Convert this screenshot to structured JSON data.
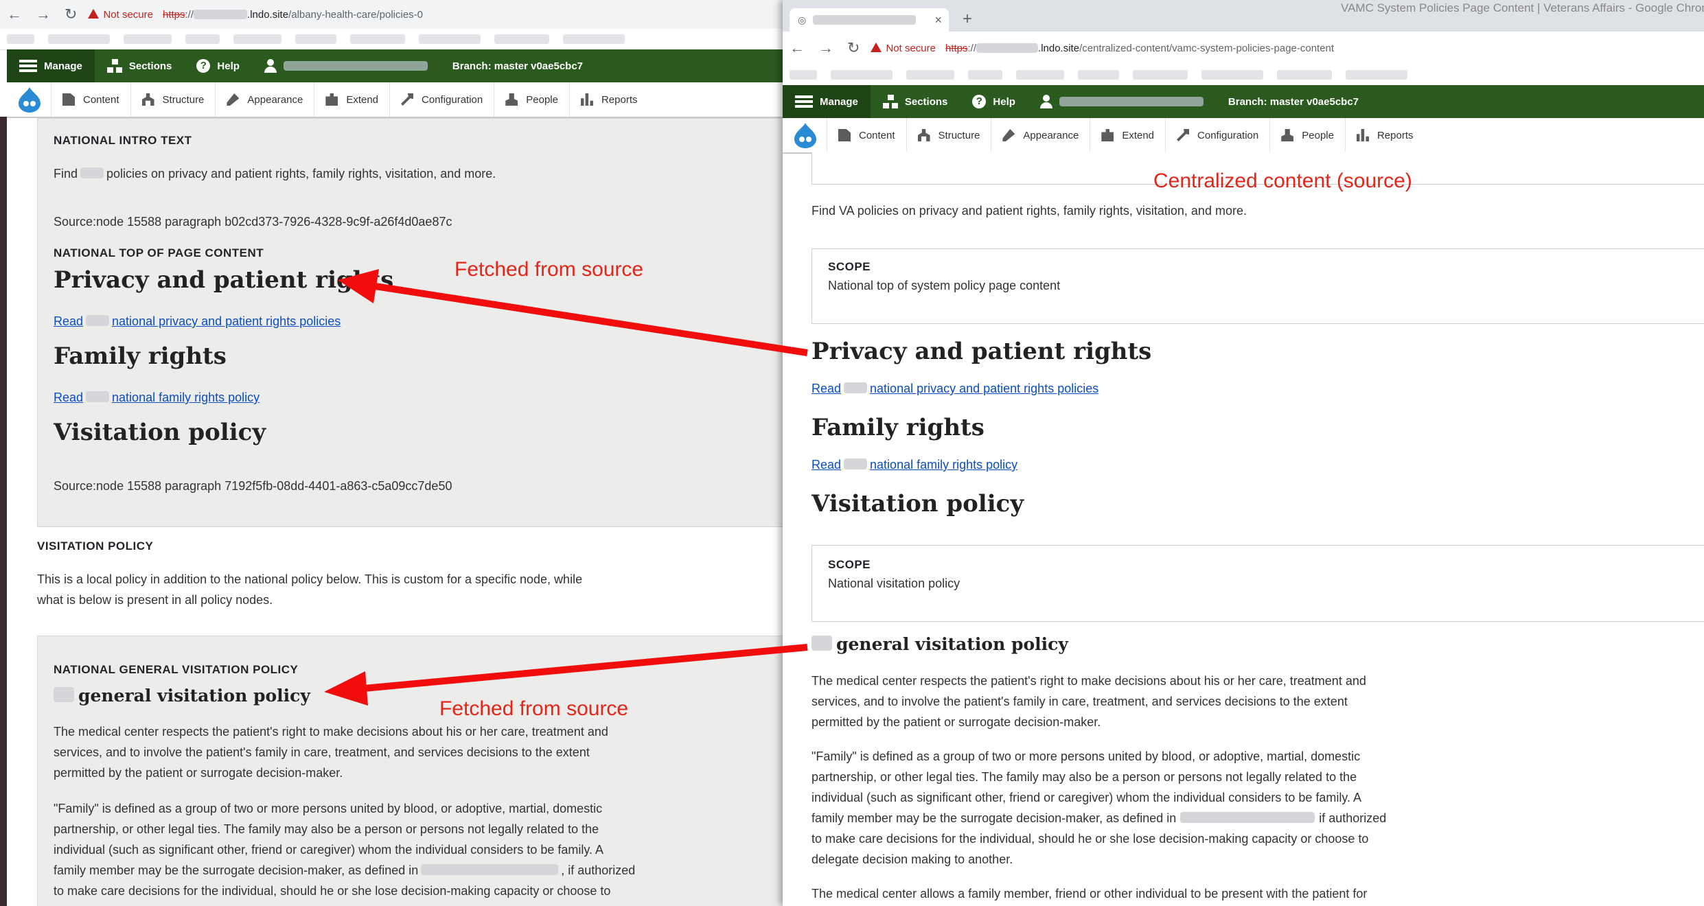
{
  "left_window": {
    "url_scheme": "https",
    "url_host_suffix": ".lndo.site",
    "url_path": "/albany-health-care/policies-0",
    "not_secure_label": "Not secure",
    "toolbar": {
      "manage": "Manage",
      "sections": "Sections",
      "help": "Help",
      "branch": "Branch: master v0ae5cbc7"
    },
    "admin_menu": [
      "Content",
      "Structure",
      "Appearance",
      "Extend",
      "Configuration",
      "People",
      "Reports"
    ],
    "national_intro": {
      "label": "NATIONAL INTRO TEXT",
      "text_prefix": "Find",
      "text_suffix": "policies on privacy and patient rights, family rights, visitation, and more.",
      "source": "Source:node 15588 paragraph b02cd373-7926-4328-9c9f-a26f4d0ae87c"
    },
    "national_top": {
      "label": "NATIONAL TOP OF PAGE CONTENT",
      "privacy_heading": "Privacy and patient rights",
      "privacy_link_prefix": "Read",
      "privacy_link_suffix": "national privacy and patient rights policies",
      "family_heading": "Family rights",
      "family_link_prefix": "Read",
      "family_link_suffix": "national family rights policy",
      "visitation_heading": "Visitation policy",
      "source": "Source:node 15588 paragraph 7192f5fb-08dd-4401-a863-c5a09cc7de50"
    },
    "visitation_policy": {
      "label": "VISITATION POLICY",
      "line1": "This is  a local policy in addition to the national policy below.   This is custom for a specific node, while",
      "line2": "what is below is present in all policy nodes."
    },
    "national_general": {
      "label": "NATIONAL GENERAL VISITATION POLICY",
      "heading_suffix": "general visitation policy",
      "para1": [
        "The medical center respects the patient's right to make decisions about his or her care, treatment and",
        "services, and to involve the patient's family in care, treatment, and services decisions to the extent",
        "permitted by the patient or surrogate decision-maker."
      ],
      "para2": [
        "\"Family\" is defined as a group of two or more persons united by blood, or adoptive, martial, domestic",
        "partnership, or other legal ties. The family may also be a person or persons not legally related to the",
        "individual (such as significant other, friend or caregiver) whom the individual considers to be family. A",
        "family member may be the surrogate decision-maker, as defined in",
        ", if authorized",
        "to make care decisions for the individual, should he or she lose decision-making capacity or choose to"
      ]
    }
  },
  "right_window": {
    "window_title": "VAMC System Policies Page Content | Veterans Affairs - Google Chrome",
    "new_tab_symbol": "+",
    "close_tab_symbol": "×",
    "url_scheme": "https",
    "url_host_suffix": ".lndo.site",
    "url_path": "/centralized-content/vamc-system-policies-page-content",
    "not_secure_label": "Not secure",
    "toolbar": {
      "manage": "Manage",
      "sections": "Sections",
      "help": "Help",
      "branch": "Branch: master v0ae5cbc7"
    },
    "admin_menu": [
      "Content",
      "Structure",
      "Appearance",
      "Extend",
      "Configuration",
      "People",
      "Reports"
    ],
    "intro_text": "Find VA policies on privacy and patient rights, family rights, visitation, and more.",
    "scope1": {
      "label": "SCOPE",
      "text": "National top of system policy page content"
    },
    "privacy_heading": "Privacy and patient rights",
    "privacy_link_prefix": "Read",
    "privacy_link_suffix": "national privacy and patient rights policies",
    "family_heading": "Family rights",
    "family_link_prefix": "Read",
    "family_link_suffix": "national family rights policy",
    "visitation_heading": "Visitation policy",
    "scope2": {
      "label": "SCOPE",
      "text": "National visitation policy"
    },
    "general_heading_suffix": "general visitation policy",
    "para1": [
      "The medical center respects the patient's right to make decisions about his or her care, treatment and",
      "services, and to involve the patient's family in care, treatment, and services decisions to the extent",
      "permitted by the patient or surrogate decision-maker."
    ],
    "para2": [
      "\"Family\" is defined as a group of two or more persons united by blood, or adoptive, martial, domestic",
      "partnership, or other legal ties. The family may also be a person or persons not legally related to the",
      "individual (such as significant other, friend or caregiver) whom the individual considers to be family. A",
      "family member may be the surrogate decision-maker, as defined in",
      "if authorized",
      "to make care decisions for the individual, should he or she lose decision-making capacity or choose to",
      "delegate decision making to another."
    ],
    "para3": "The medical center allows a family member, friend or other individual to be present with the patient for"
  },
  "annotations": {
    "centralized": "Centralized content (source)",
    "fetched1": "Fetched from source",
    "fetched2": "Fetched from source",
    "arrow_color": "#f20d0d"
  },
  "colors": {
    "toolbar_green": "#2b5a1f",
    "link_blue": "#0b4dc2",
    "annotation_red": "#e4251a",
    "panel_gray": "#ececeb"
  }
}
